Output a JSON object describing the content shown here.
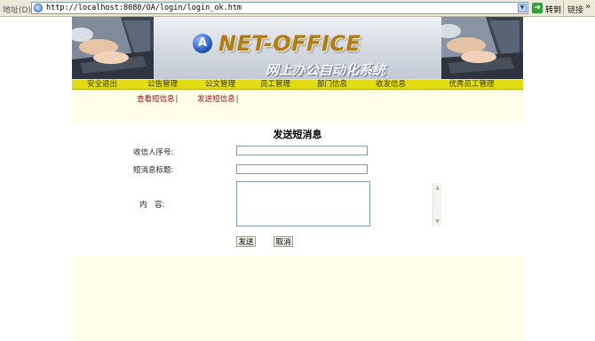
{
  "browser": {
    "address_label": "地址(D)",
    "url": "http://localhost:8080/OA/login/login_ok.htm",
    "go_label": "转到",
    "links_label": "链接"
  },
  "banner": {
    "logo_letter": "A",
    "logo_text": "NET-OFFICE",
    "subtitle": "网上办公自动化系统"
  },
  "nav": {
    "items": [
      {
        "label": "安全退出"
      },
      {
        "label": "公告管理"
      },
      {
        "label": "公文管理"
      },
      {
        "label": "员工管理"
      },
      {
        "label": "部门信息"
      },
      {
        "label": "收发信息"
      },
      {
        "label": "优秀员工管理"
      }
    ]
  },
  "sublinks": {
    "view_messages": "查看短信息",
    "send_messages": "发送短信息",
    "separator": "|"
  },
  "form": {
    "title": "发送短消息",
    "recipient_label": "收信人序号:",
    "recipient_value": "",
    "subject_label": "短消息标题:",
    "subject_value": "",
    "content_label": "内　容:",
    "content_value": "",
    "send_button": "发送",
    "cancel_button": "取消"
  },
  "colors": {
    "nav_bg": "#e2dc15",
    "page_bg": "#ffffe8",
    "sublink": "#8b1010",
    "logo_text": "#b07c18"
  }
}
